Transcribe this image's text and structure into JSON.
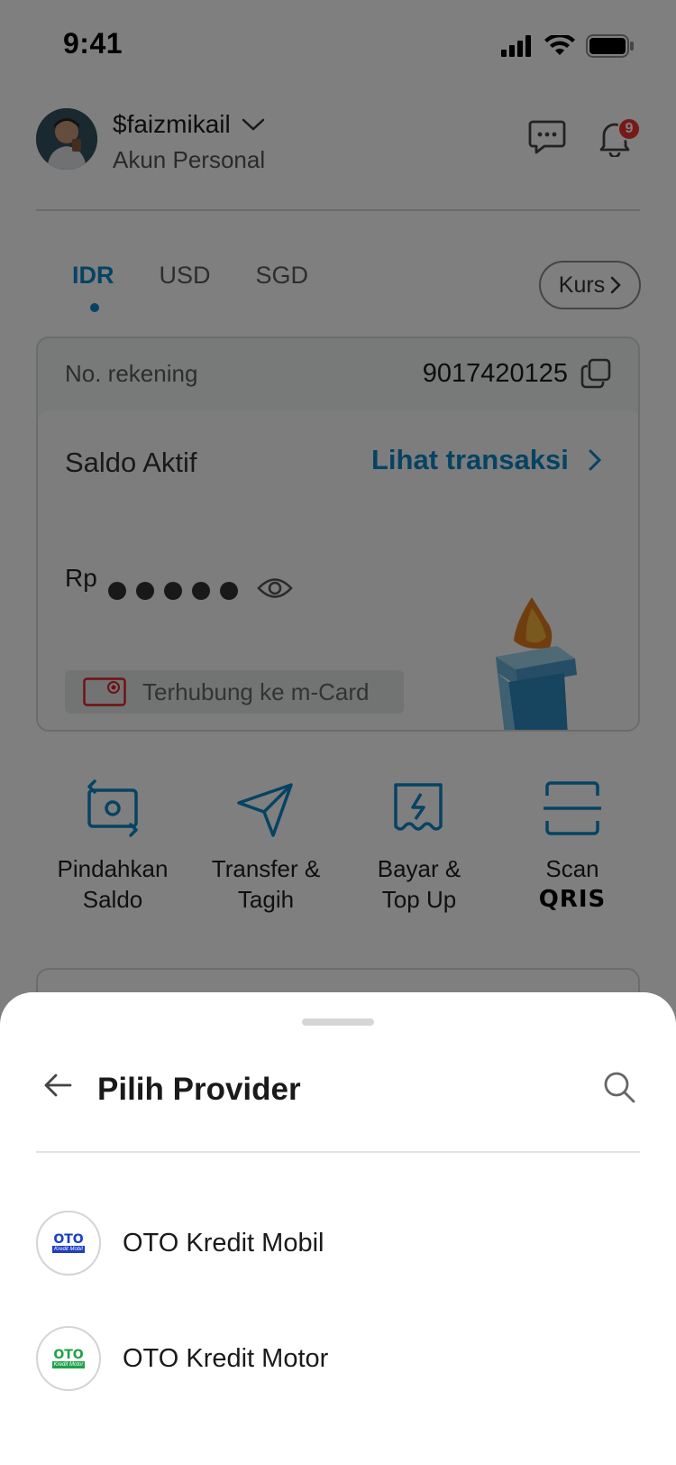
{
  "status_bar": {
    "time": "9:41"
  },
  "profile": {
    "username": "$faizmikail",
    "account_type": "Akun Personal",
    "notification_count": "9"
  },
  "currency_tabs": [
    {
      "label": "IDR",
      "active": true
    },
    {
      "label": "USD",
      "active": false
    },
    {
      "label": "SGD",
      "active": false
    }
  ],
  "kurs_label": "Kurs",
  "account": {
    "number_label": "No. rekening",
    "number": "9017420125",
    "balance_label": "Saldo Aktif",
    "view_transactions": "Lihat transaksi",
    "currency_symbol": "Rp",
    "mcard_text": "Terhubung ke m-Card"
  },
  "actions": [
    {
      "line1": "Pindahkan",
      "line2": "Saldo",
      "icon": "move-balance-icon"
    },
    {
      "line1": "Transfer &",
      "line2": "Tagih",
      "icon": "send-icon"
    },
    {
      "line1": "Bayar &",
      "line2": "Top Up",
      "icon": "bill-icon"
    },
    {
      "line1": "Scan",
      "line2": "QRIS",
      "icon": "scan-icon"
    }
  ],
  "sheet": {
    "title": "Pilih Provider",
    "providers": [
      {
        "name": "OTO Kredit Mobil",
        "logo_text": "OTO",
        "logo_sub": "Kredit Mobil",
        "color": "#1b3fbf"
      },
      {
        "name": "OTO Kredit Motor",
        "logo_text": "OTO",
        "logo_sub": "Kredit Motor",
        "color": "#1fa14a"
      }
    ]
  },
  "colors": {
    "accent": "#0d86c7",
    "badge": "#e33333",
    "overlay": "rgba(0,0,0,0.5)"
  }
}
